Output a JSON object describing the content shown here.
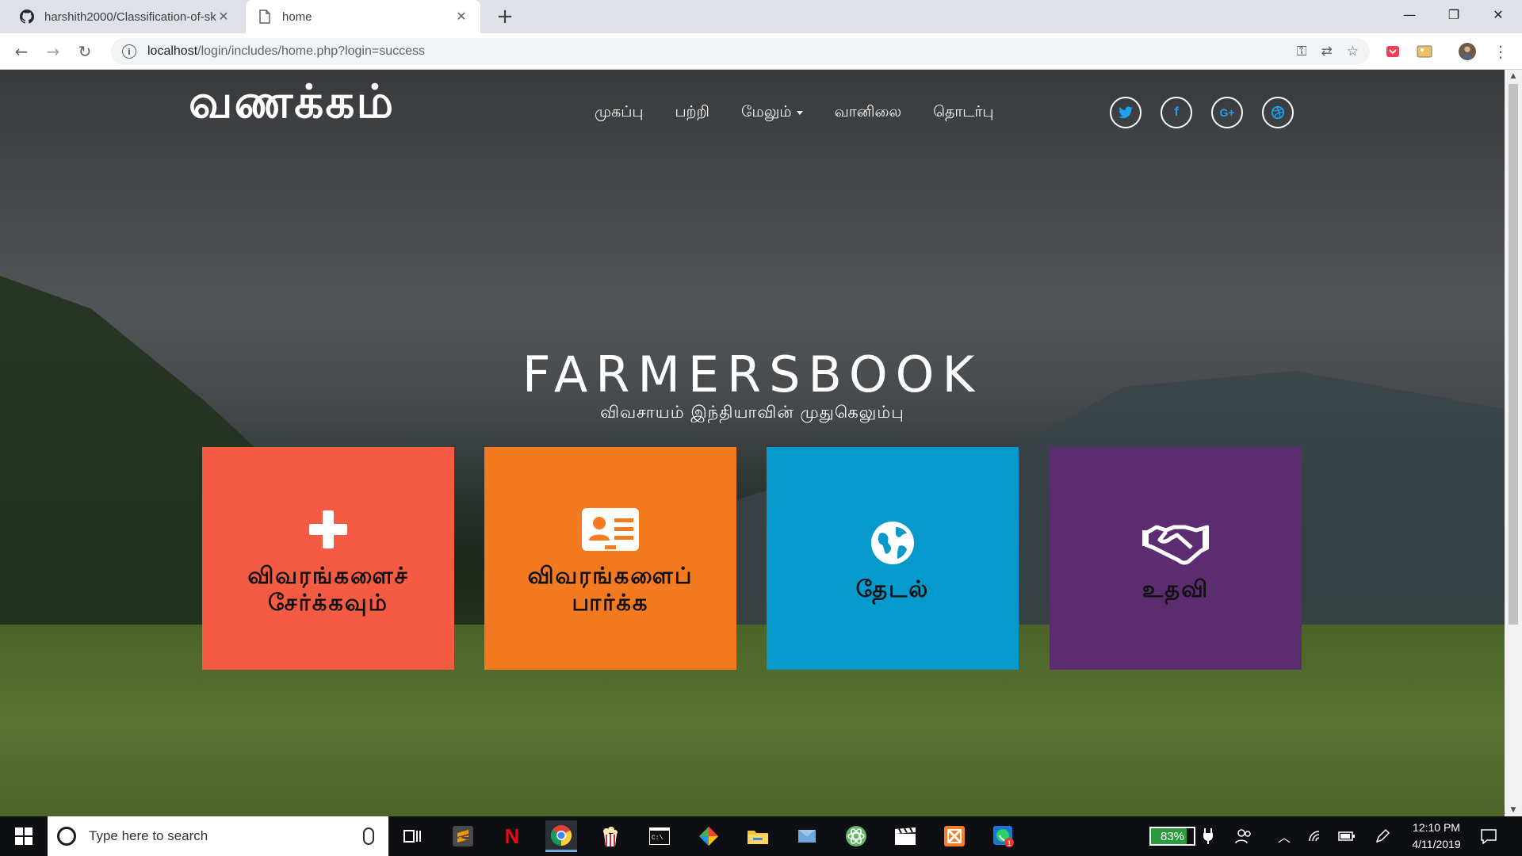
{
  "browser": {
    "tabs": [
      {
        "title": "harshith2000/Classification-of-sk",
        "active": false
      },
      {
        "title": "home",
        "active": true
      }
    ],
    "url_host": "localhost",
    "url_path": "/login/includes/home.php?login=success"
  },
  "page": {
    "brand": "வணக்கம்",
    "nav": [
      "முகப்பு",
      "பற்றி",
      "மேலும்",
      "வானிலை",
      "தொடர்பு"
    ],
    "social": [
      "twitter-icon",
      "facebook-icon",
      "google-plus-icon",
      "dribbble-icon"
    ],
    "hero_title": "FARMERSBOOK",
    "hero_subtitle": "விவசாயம் இந்தியாவின் முதுகெலும்பு",
    "tiles": [
      {
        "line1": "விவரங்களைச்",
        "line2": "சேர்க்கவும்",
        "icon": "plus-icon",
        "color": "#f55a42"
      },
      {
        "line1": "விவரங்களைப்",
        "line2": "பார்க்க",
        "icon": "id-card-icon",
        "color": "#f47a22"
      },
      {
        "line1": "",
        "line2": "தேடல்",
        "icon": "globe-icon",
        "color": "#0599cc"
      },
      {
        "line1": "",
        "line2": "உதவி",
        "icon": "handshake-icon",
        "color": "#5b2d70"
      }
    ]
  },
  "taskbar": {
    "search_placeholder": "Type here to search",
    "battery": "83%",
    "battery_level": 0.83,
    "time": "12:10 PM",
    "date": "4/11/2019"
  }
}
